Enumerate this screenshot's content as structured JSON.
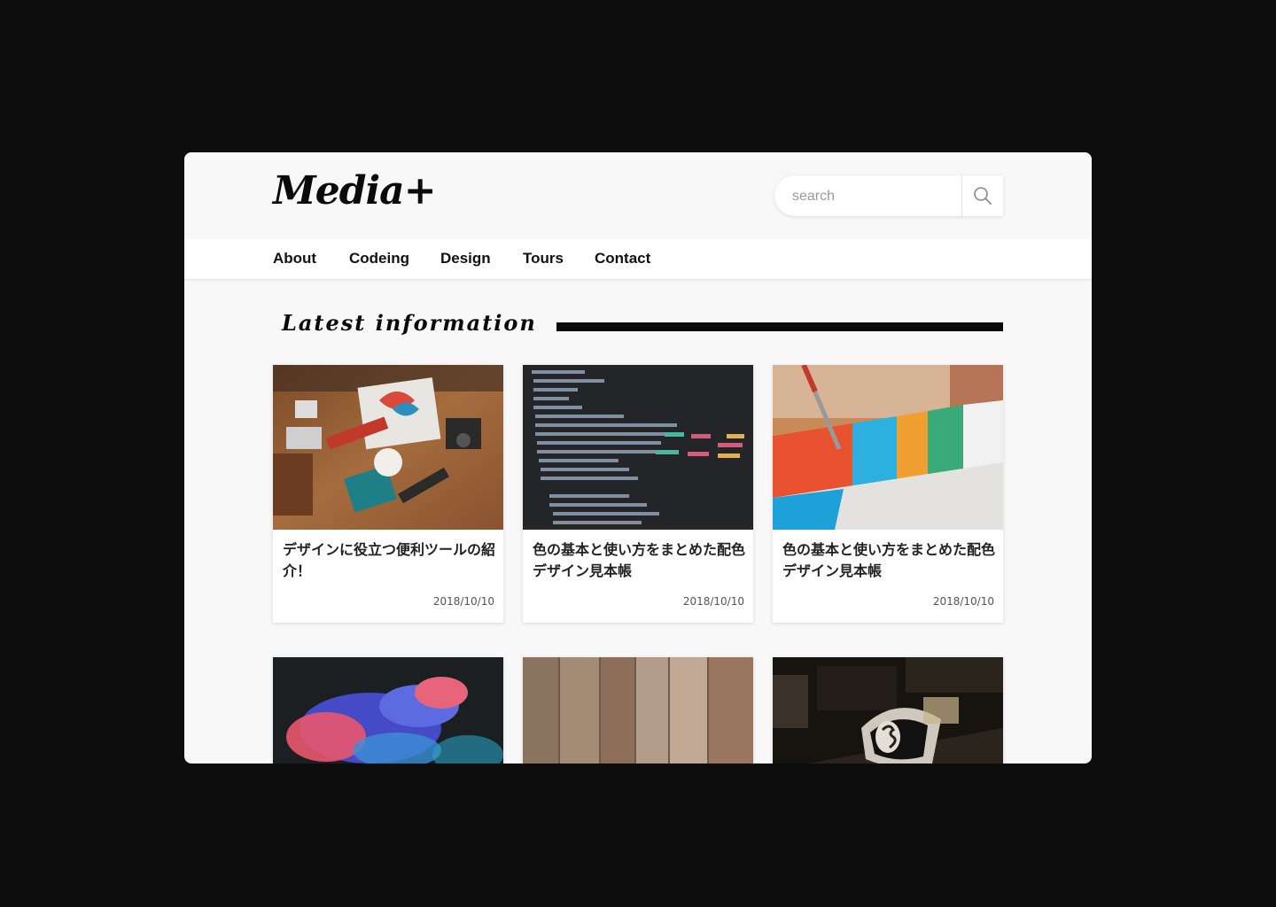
{
  "header": {
    "logo": "Media+",
    "search_placeholder": "search"
  },
  "nav": {
    "items": [
      {
        "label": "About"
      },
      {
        "label": "Codeing"
      },
      {
        "label": "Design"
      },
      {
        "label": "Tours"
      },
      {
        "label": "Contact"
      }
    ]
  },
  "section": {
    "title": "Latest information"
  },
  "cards": [
    {
      "title": "デザインに役立つ便利ツールの紹介！",
      "date": "2018/10/10",
      "image": "design-desk-photo"
    },
    {
      "title": "色の基本と使い方をまとめた配色デザイン見本帳",
      "date": "2018/10/10",
      "image": "code-screen-photo"
    },
    {
      "title": "色の基本と使い方をまとめた配色デザイン見本帳",
      "date": "2018/10/10",
      "image": "painted-board-photo"
    },
    {
      "title": "",
      "date": "",
      "image": "color-smoke-photo"
    },
    {
      "title": "",
      "date": "",
      "image": "wood-planks-photo"
    },
    {
      "title": "",
      "date": "",
      "image": "dark-sofa-photo"
    }
  ],
  "colors": {
    "background": "#0d0d0d",
    "page": "#f8f8f8",
    "text": "#0a0a0a"
  }
}
